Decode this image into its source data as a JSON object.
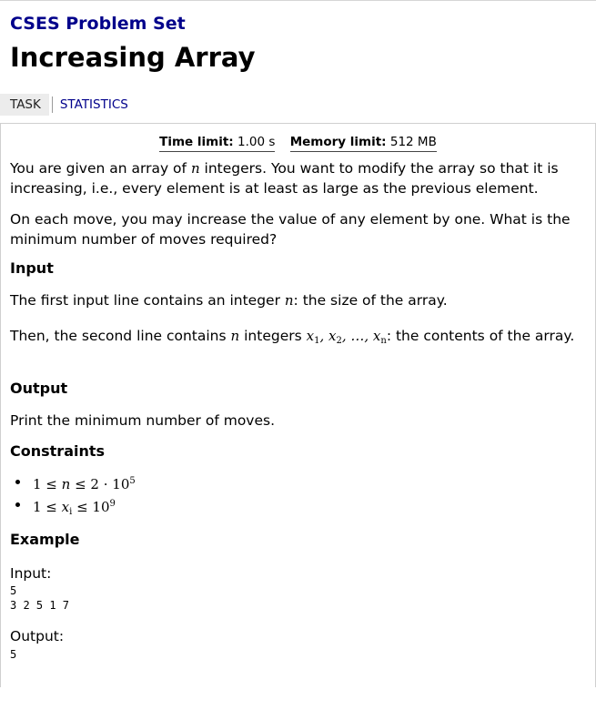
{
  "site": {
    "title": "CSES Problem Set"
  },
  "problem": {
    "title": "Increasing Array",
    "time_limit_label": "Time limit:",
    "time_limit_value": "1.00 s",
    "memory_limit_label": "Memory limit:",
    "memory_limit_value": "512 MB"
  },
  "nav": {
    "task": "TASK",
    "statistics": "STATISTICS"
  },
  "statement": {
    "p1": {
      "a": "You are given an array of ",
      "var": "n",
      "b": " integers. You want to modify the array so that it is increasing, i.e., every element is at least as large as the previous element."
    },
    "p2": "On each move, you may increase the value of any element by one. What is the minimum number of moves required?"
  },
  "input_section": {
    "heading": "Input",
    "line1": {
      "a": "The first input line contains an integer ",
      "var": "n",
      "b": ": the size of the array."
    },
    "line2": {
      "a": "Then, the second line contains ",
      "var": "n",
      "b": " integers ",
      "c": ": the contents of the array."
    }
  },
  "output_section": {
    "heading": "Output",
    "text": "Print the minimum number of moves."
  },
  "constraints_section": {
    "heading": "Constraints"
  },
  "example_section": {
    "heading": "Example",
    "input_label": "Input:",
    "input_lines": "5\n3 2 5 1 7",
    "output_label": "Output:",
    "output_lines": "5"
  },
  "colors": {
    "link": "#00008b",
    "tab_bg": "#ececec",
    "border": "#cfcfcf"
  }
}
